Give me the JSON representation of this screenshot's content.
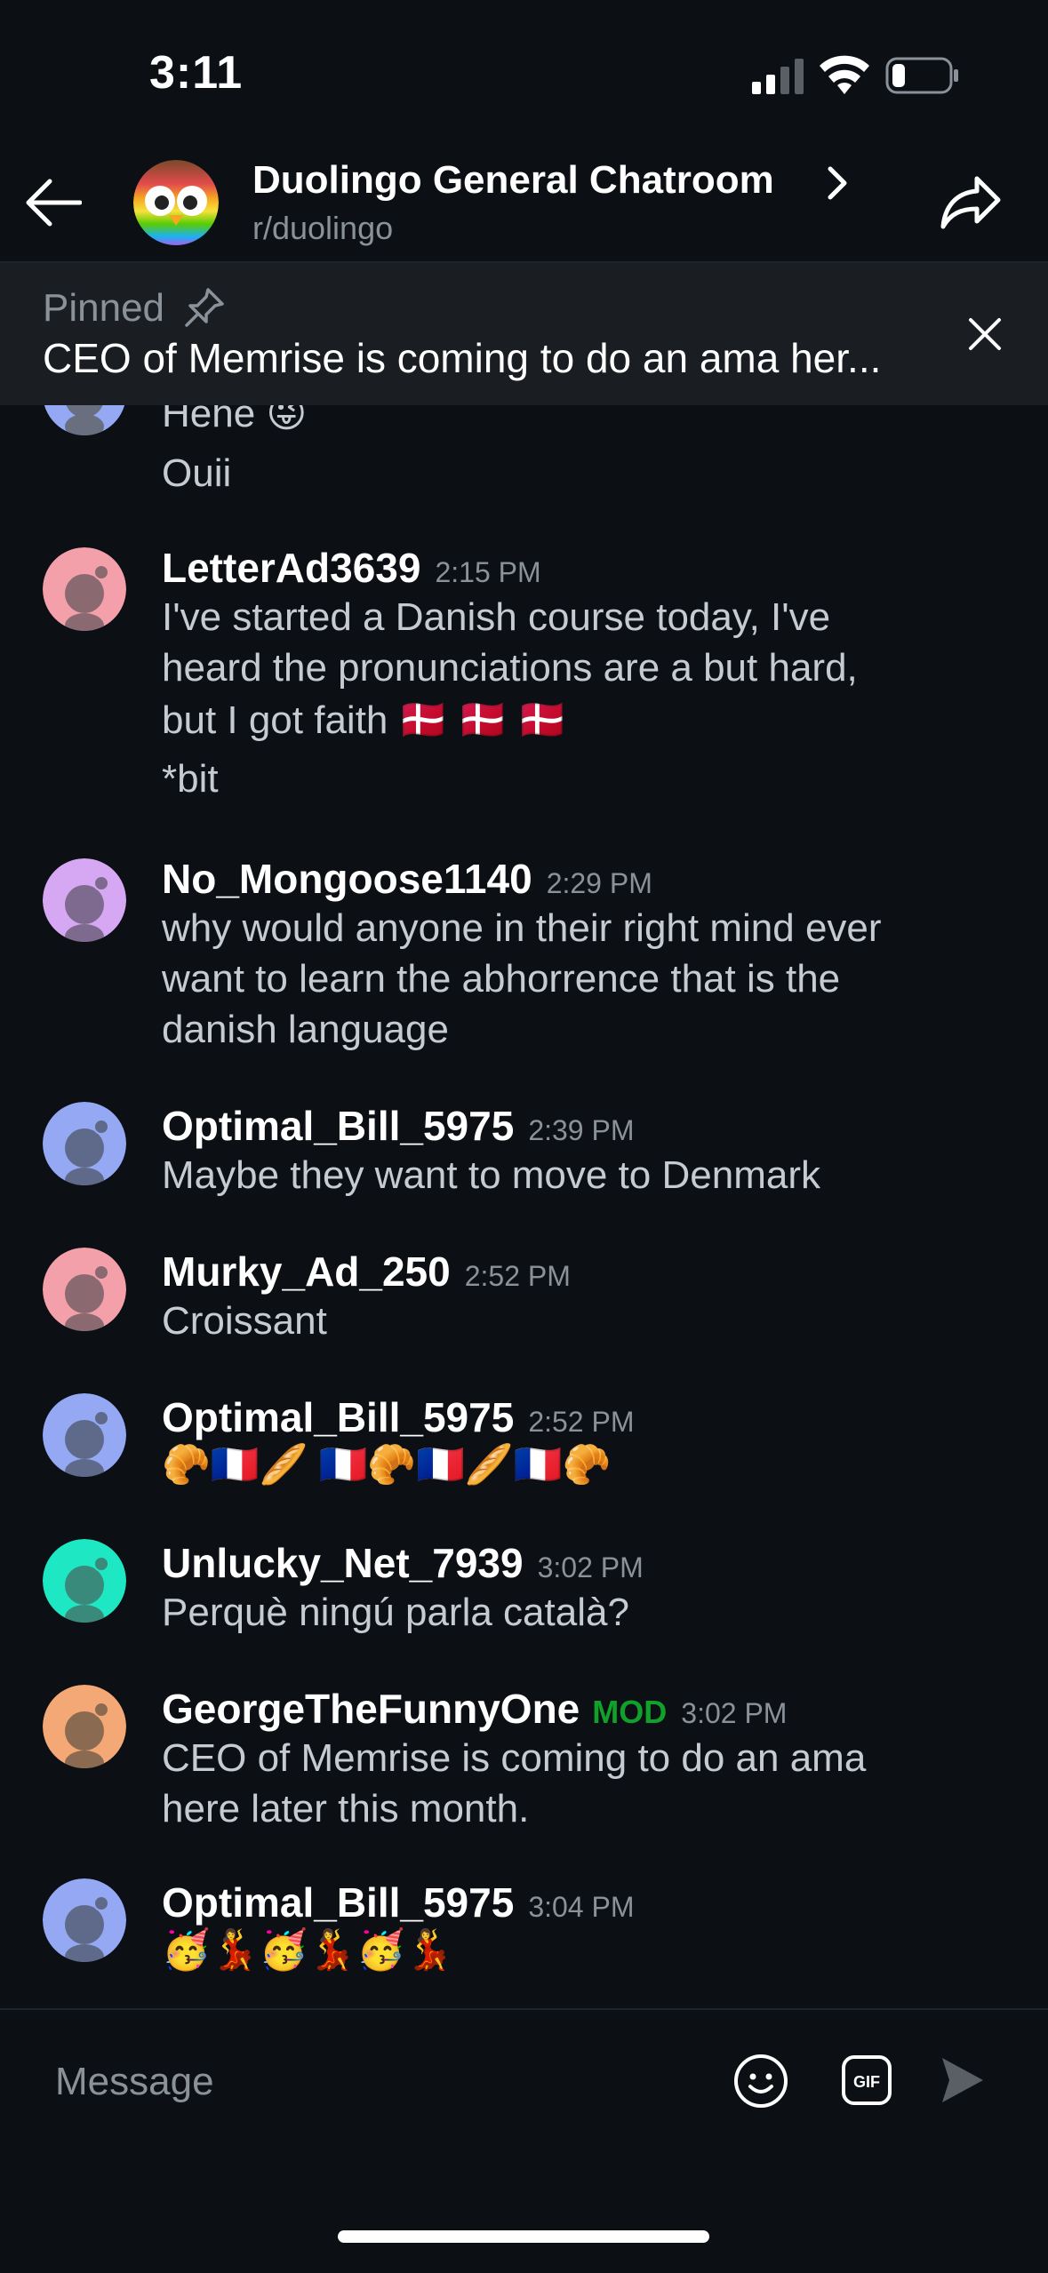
{
  "status_bar": {
    "time": "3:11"
  },
  "header": {
    "title": "Duolingo General Chatroom",
    "subreddit": "r/duolingo",
    "back_icon": "arrow-left-icon",
    "share_icon": "share-icon"
  },
  "pinned": {
    "label": "Pinned",
    "text": "CEO of Memrise is coming to do an ama her..."
  },
  "messages": [
    {
      "partial": true,
      "lines": [
        "Hehe 😜",
        "Ouii"
      ]
    },
    {
      "username": "LetterAd3639",
      "time": "2:15 PM",
      "color": "#f4a0ab",
      "lines": [
        "I've started a Danish course today, I've",
        "heard the pronunciations are a but hard,",
        "but I got faith 🇩🇰 🇩🇰 🇩🇰",
        "*bit"
      ]
    },
    {
      "username": "No_Mongoose1140",
      "time": "2:29 PM",
      "color": "#d6a8f4",
      "lines": [
        "why would anyone in their right mind ever",
        "want to learn the abhorrence that is the",
        "danish language"
      ]
    },
    {
      "username": "Optimal_Bill_5975",
      "time": "2:39 PM",
      "color": "#94a8f4",
      "lines": [
        "Maybe they want to move to Denmark"
      ]
    },
    {
      "username": "Murky_Ad_250",
      "time": "2:52 PM",
      "color": "#f4a0ab",
      "lines": [
        "Croissant"
      ]
    },
    {
      "username": "Optimal_Bill_5975",
      "time": "2:52 PM",
      "color": "#94a8f4",
      "lines": [
        "🥐🇫🇷🥖 🇫🇷🥐🇫🇷🥖🇫🇷🥐"
      ]
    },
    {
      "username": "Unlucky_Net_7939",
      "time": "3:02 PM",
      "color": "#1ee8c3",
      "lines": [
        "Perquè  ningú parla català?"
      ]
    },
    {
      "username": "GeorgeTheFunnyOne",
      "badge": "MOD",
      "time": "3:02 PM",
      "color": "#f4a876",
      "lines": [
        "CEO of Memrise is coming to do an ama",
        "here later this month."
      ]
    },
    {
      "username": "Optimal_Bill_5975",
      "time": "3:04 PM",
      "color": "#94a8f4",
      "lines": [
        "🥳💃🥳💃🥳💃"
      ]
    }
  ],
  "composer": {
    "placeholder": "Message",
    "gif_label": "GIF"
  },
  "colors": {
    "background": "#0c1015",
    "mod_green": "#11a02a"
  }
}
